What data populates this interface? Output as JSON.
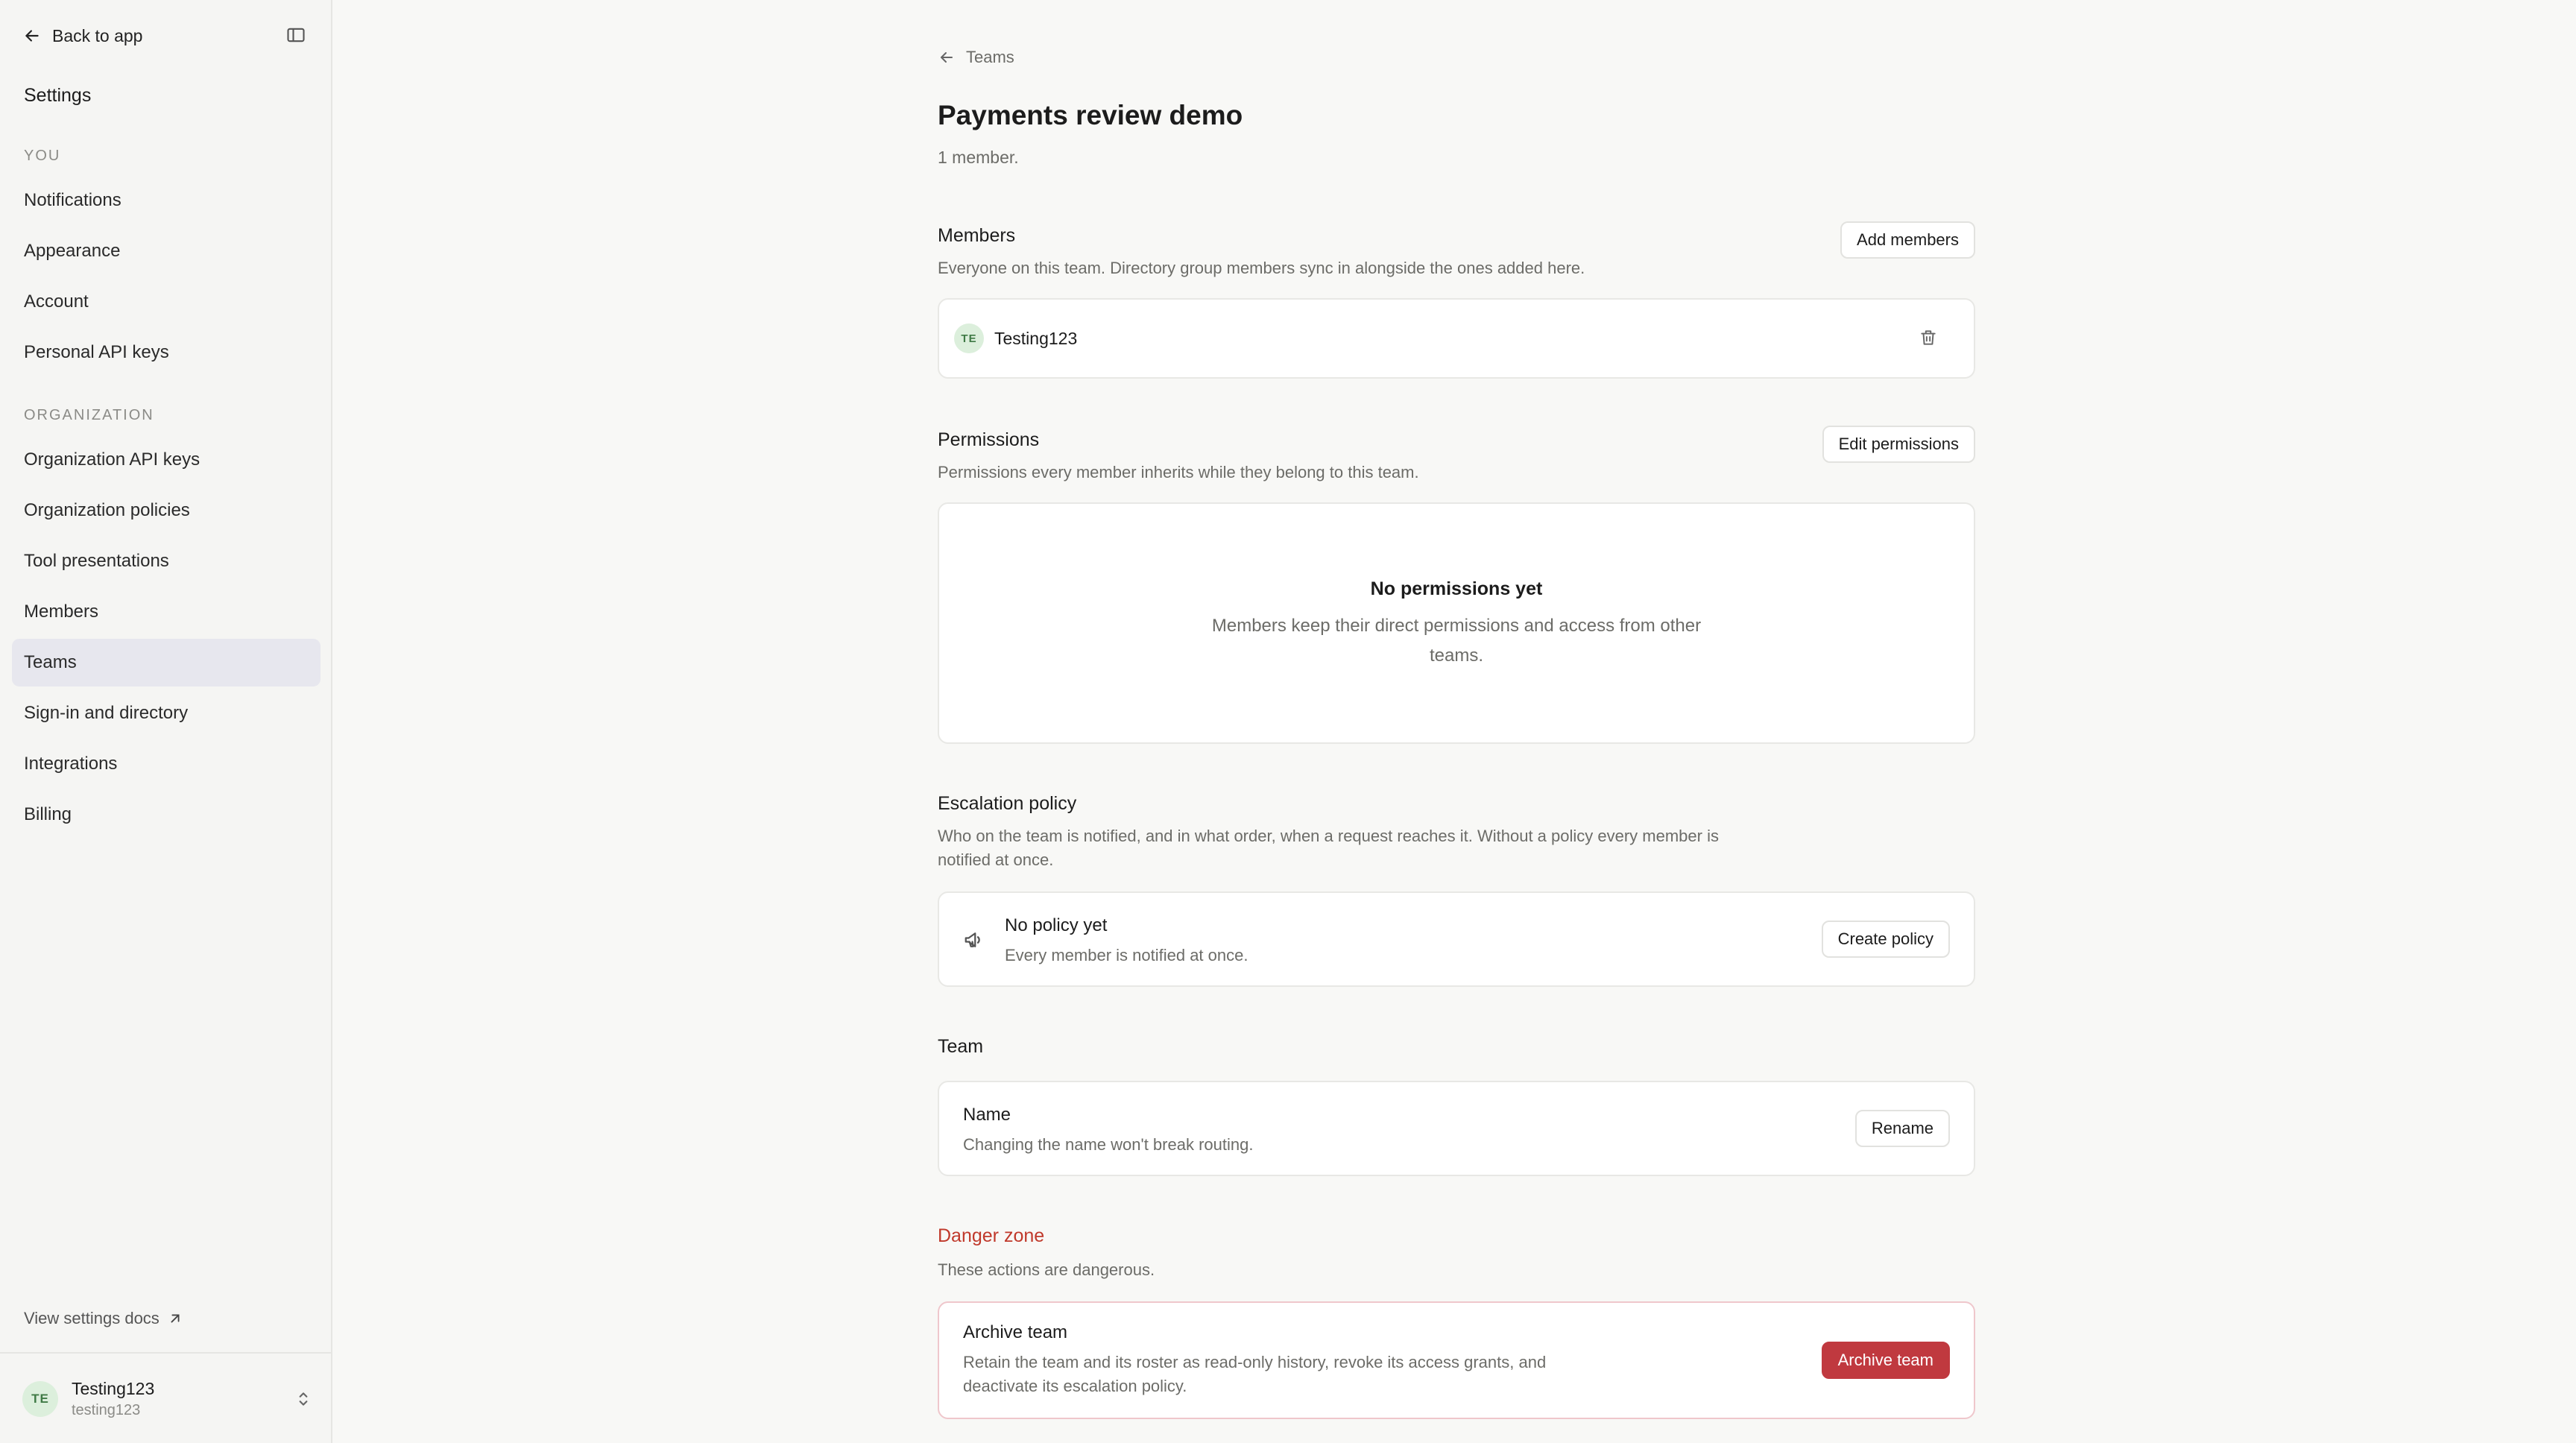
{
  "sidebar": {
    "back_label": "Back to app",
    "title": "Settings",
    "you_label": "YOU",
    "you_items": [
      {
        "label": "Notifications"
      },
      {
        "label": "Appearance"
      },
      {
        "label": "Account"
      },
      {
        "label": "Personal API keys"
      }
    ],
    "org_label": "ORGANIZATION",
    "org_items": [
      {
        "label": "Organization API keys"
      },
      {
        "label": "Organization policies"
      },
      {
        "label": "Tool presentations"
      },
      {
        "label": "Members"
      },
      {
        "label": "Teams",
        "active": true
      },
      {
        "label": "Sign-in and directory"
      },
      {
        "label": "Integrations"
      },
      {
        "label": "Billing"
      }
    ],
    "docs_label": "View settings docs",
    "user": {
      "initials": "TE",
      "name": "Testing123",
      "handle": "testing123"
    }
  },
  "main": {
    "breadcrumb": "Teams",
    "title": "Payments review demo",
    "subtitle": "1 member.",
    "members": {
      "title": "Members",
      "description": "Everyone on this team. Directory group members sync in alongside the ones added here.",
      "add_button": "Add members",
      "list": [
        {
          "initials": "TE",
          "name": "Testing123"
        }
      ]
    },
    "permissions": {
      "title": "Permissions",
      "description": "Permissions every member inherits while they belong to this team.",
      "edit_button": "Edit permissions",
      "empty_title": "No permissions yet",
      "empty_desc": "Members keep their direct permissions and access from other teams."
    },
    "escalation": {
      "title": "Escalation policy",
      "description": "Who on the team is notified, and in what order, when a request reaches it. Without a policy every member is notified at once.",
      "card_title": "No policy yet",
      "card_desc": "Every member is notified at once.",
      "create_button": "Create policy"
    },
    "team": {
      "title": "Team",
      "name_title": "Name",
      "name_desc": "Changing the name won't break routing.",
      "rename_button": "Rename"
    },
    "danger": {
      "title": "Danger zone",
      "description": "These actions are dangerous.",
      "archive_title": "Archive team",
      "archive_desc": "Retain the team and its roster as read-only history, revoke its access grants, and deactivate its escalation policy.",
      "archive_button": "Archive team"
    }
  },
  "colors": {
    "accent_danger": "#c0393f",
    "active_nav": "#e7e7ee",
    "avatar_bg": "#dcefdc"
  }
}
